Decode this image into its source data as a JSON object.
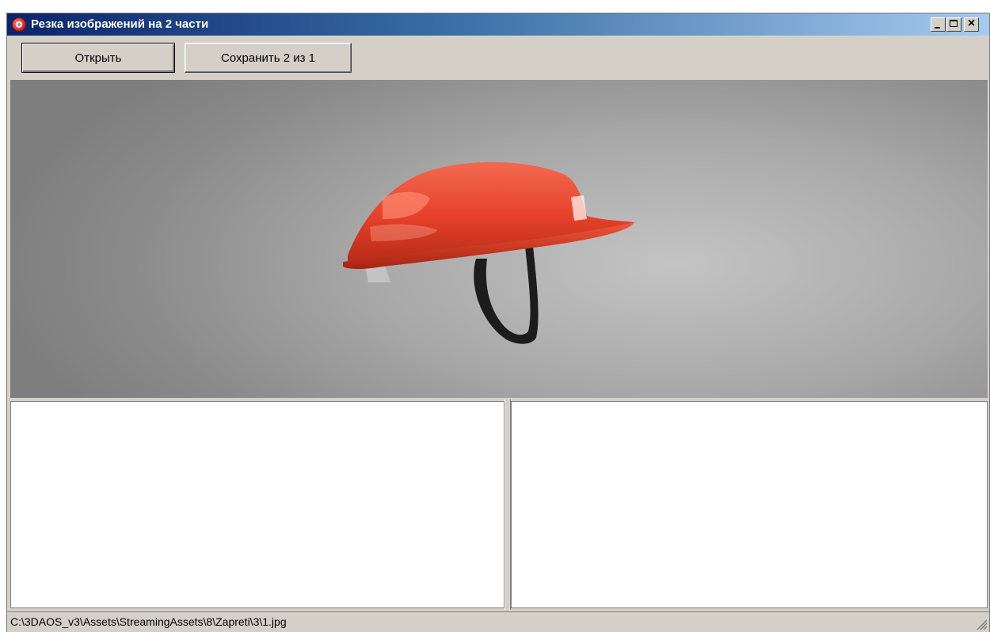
{
  "window": {
    "title": "Резка изображений на 2 части"
  },
  "toolbar": {
    "open_label": "Открыть",
    "save_label": "Сохранить 2 из 1"
  },
  "status": {
    "path": "C:\\3DAOS_v3\\Assets\\StreamingAssets\\8\\Zapreti\\3\\1.jpg"
  },
  "preview": {
    "subject": "red safety helmet with black chin strap on gray background"
  },
  "colors": {
    "title_start": "#0a246a",
    "title_end": "#a6caf0",
    "face": "#d4d0c8",
    "helmet": "#e8432c"
  }
}
